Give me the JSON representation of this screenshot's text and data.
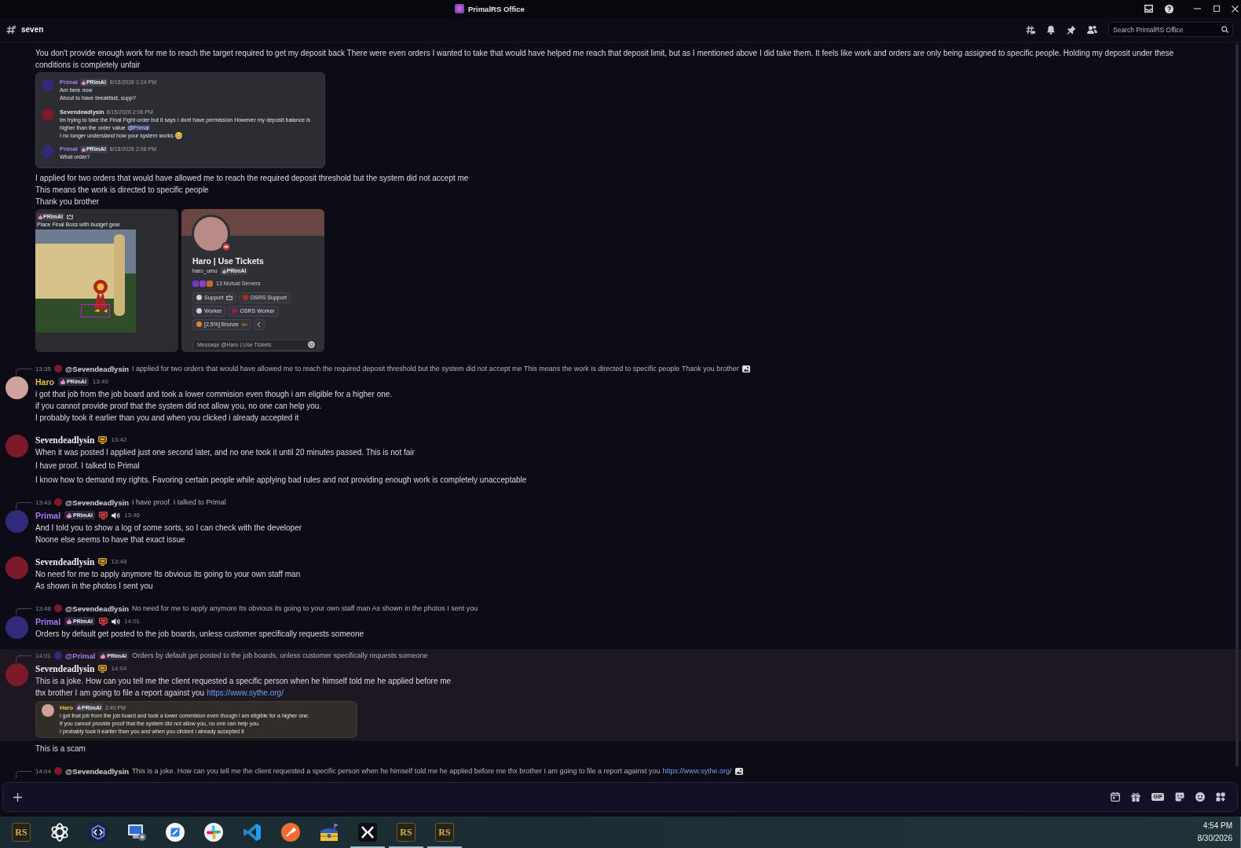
{
  "window": {
    "title": "PrimalRS Office"
  },
  "channel_header": {
    "channel": "seven",
    "search": {
      "placeholder": "Search PrimalRS Office"
    }
  },
  "messages": [
    {
      "highlighted": false,
      "blocks": [
        {
          "kind": "text",
          "lines": [
            {
              "text": "You don't provide enough work for me to reach the target required to get my deposit back There were even orders I wanted to take that would have helped me reach that deposit limit, but as I mentioned above I did take them. It feels like work and orders are only being assigned to specific people. Holding my deposit under these conditions is completely unfair"
            }
          ]
        },
        {
          "kind": "chat-screenshot",
          "messages": [
            {
              "name": "Primal",
              "color": "#a47cf5",
              "avatar": {
                "color": "#302a78"
              },
              "badge": "PRimAl",
              "time": "8/15/2026 1:24 PM",
              "lines": [
                {
                  "text": "Am here now"
                },
                {
                  "text": "About to have breakfast, supp?"
                }
              ]
            },
            {
              "name": "Sevendeadlysin",
              "color": "#e4e4e8",
              "avatar": {
                "color": "#7c1a2a"
              },
              "time": "8/15/2026 2:06 PM",
              "lines": [
                {
                  "text": "Im trying to take the Final Fight order but it says I dont have permission However my deposit balance is higher than the order value",
                  "mention": "@Primal"
                },
                {
                  "text": "I no longer understand how your system works",
                  "emoji": true
                }
              ]
            },
            {
              "name": "Primal",
              "color": "#a47cf5",
              "avatar": {
                "color": "#302a78"
              },
              "badge": "PRimAl",
              "time": "8/15/2026 2:08 PM",
              "lines": [
                {
                  "text": "What order?"
                }
              ]
            }
          ]
        },
        {
          "kind": "text",
          "lines": [
            {
              "text": "I applied for two orders that would have allowed me to reach the required deposit threshold but the system did not accept me"
            },
            {
              "text": "This means the work is directed to specific people"
            },
            {
              "text": "Thank you brother"
            }
          ]
        },
        {
          "kind": "image-row",
          "images": [
            {
              "kind": "game-screenshot",
              "badge": "PRimAl",
              "caption": "Place Final Boss with budget gear"
            },
            {
              "kind": "profile-card",
              "name": "Haro | Use Tickets",
              "username": "haro_umu",
              "badge": "PRimAl",
              "mutual": "13 Mutual Servers",
              "roles": [
                {
                  "kind": "crowned",
                  "label": "Support",
                  "color": "#d0d0d4"
                },
                {
                  "kind": "plain",
                  "label": "OSRS Support",
                  "color": "#b02a22"
                },
                {
                  "kind": "plain",
                  "label": "Worker",
                  "color": "#d0d0d4"
                },
                {
                  "kind": "plain",
                  "label": "OSRS Worker",
                  "color": "#8f1f4d"
                },
                {
                  "kind": "ranked",
                  "label": "[2.5%] Bronze",
                  "color": "#dc862e"
                }
              ],
              "placeholder": "Message @Haro | Use Tickets"
            }
          ]
        }
      ]
    },
    {
      "highlighted": false,
      "reply": {
        "time": "13:35",
        "name": "@Sevendeadlysin",
        "color": "#d6d7dd",
        "avatar": {
          "color": "#7c1a2a"
        },
        "text": "I applied for two orders that would have allowed me to reach the required deposit threshold but the system did not accept me This means the work is directed to specific people Thank you brother",
        "image": true
      },
      "author": {
        "name": "Haro",
        "color": "#e7bf45",
        "fancy_name": false,
        "avatar": {
          "color": "#cfa39b"
        },
        "badge": "PRimAl"
      },
      "time": "13:40",
      "blocks": [
        {
          "kind": "text",
          "lines": [
            {
              "text": "i got that job from the job board and took a lower commision even though i am eligible for a higher one."
            },
            {
              "text": "if you cannot provide proof that the system did not allow you, no one can help you."
            },
            {
              "text": "I probably took it earlier than you and when you clicked i already accepted it"
            }
          ]
        }
      ]
    },
    {
      "highlighted": false,
      "author": {
        "name": "Sevendeadlysin",
        "color": "#f0f0f2",
        "fancy_name": true,
        "avatar": {
          "color": "#7c1a2a"
        },
        "icons": [
          {
            "kind": "screen",
            "color": "#e2a72e"
          }
        ]
      },
      "time": "13:42",
      "blocks": [
        {
          "kind": "text",
          "lines": [
            {
              "text": "When it was posted I applied just one second later, and no one took it until 20 minutes passed. This is not fair"
            }
          ]
        },
        {
          "kind": "text",
          "lines": [
            {
              "text": "I have proof. I talked to Primal"
            }
          ]
        },
        {
          "kind": "text",
          "lines": [
            {
              "text": "I know how to demand my rights. Favoring certain people while applying bad rules and not providing enough work is completely unacceptable"
            }
          ]
        }
      ]
    },
    {
      "highlighted": false,
      "reply": {
        "time": "13:43",
        "name": "@Sevendeadlysin",
        "color": "#d6d7dd",
        "avatar": {
          "color": "#7c1a2a"
        },
        "text": "I have proof. I talked to Primal",
        "image": false
      },
      "author": {
        "name": "Primal",
        "color": "#a47cf5",
        "fancy_name": false,
        "avatar": {
          "color": "#302a78"
        },
        "badge": "PRimAl",
        "icons": [
          {
            "kind": "screen",
            "color": "#e0454c"
          },
          {
            "kind": "speaker"
          }
        ]
      },
      "time": "13:46",
      "blocks": [
        {
          "kind": "text",
          "lines": [
            {
              "text": "And I told you to show a log of some sorts, so I can check with the developer"
            },
            {
              "text": "Noone else seems to have that exact issue"
            }
          ]
        }
      ]
    },
    {
      "highlighted": false,
      "author": {
        "name": "Sevendeadlysin",
        "color": "#f0f0f2",
        "fancy_name": true,
        "avatar": {
          "color": "#7c1a2a"
        },
        "icons": [
          {
            "kind": "screen",
            "color": "#e2a72e"
          }
        ]
      },
      "time": "13:48",
      "blocks": [
        {
          "kind": "text",
          "lines": [
            {
              "text": "No need for me to apply anymore Its obvious its going to your own staff man"
            },
            {
              "text": "As shown in the photos I sent you"
            }
          ]
        }
      ]
    },
    {
      "highlighted": false,
      "reply": {
        "time": "13:48",
        "name": "@Sevendeadlysin",
        "color": "#d6d7dd",
        "avatar": {
          "color": "#7c1a2a"
        },
        "text": "No need for me to apply anymore Its obvious its going to your own staff man As shown in the photos I sent you",
        "image": false
      },
      "author": {
        "name": "Primal",
        "color": "#a47cf5",
        "fancy_name": false,
        "avatar": {
          "color": "#302a78"
        },
        "badge": "PRimAl",
        "icons": [
          {
            "kind": "screen",
            "color": "#e0454c"
          },
          {
            "kind": "speaker"
          }
        ]
      },
      "time": "14:01",
      "blocks": [
        {
          "kind": "text",
          "lines": [
            {
              "text": "Orders by default get posted to the job boards, unless customer specifically requests someone"
            }
          ]
        }
      ]
    },
    {
      "highlighted": true,
      "reply": {
        "time": "14:01",
        "name": "@Primal",
        "color": "#a47cf5",
        "avatar": {
          "color": "#302a78"
        },
        "badge": "PRimAl",
        "text": "Orders by default get posted to the job boards, unless customer specifically requests someone",
        "image": false
      },
      "author": {
        "name": "Sevendeadlysin",
        "color": "#f0f0f2",
        "fancy_name": true,
        "avatar": {
          "color": "#7c1a2a"
        },
        "icons": [
          {
            "kind": "screen",
            "color": "#e2a72e"
          }
        ]
      },
      "time": "14:04",
      "blocks": [
        {
          "kind": "text",
          "lines": [
            {
              "text": "This is a joke. How can you tell me the client requested a specific person when he himself told me he applied before me"
            },
            {
              "text": "thx brother I am going to file a report against you",
              "link": "https://www.sythe.org/"
            }
          ]
        },
        {
          "kind": "chat-screenshot",
          "messages": [
            {
              "name": "Haro",
              "color": "#e7bf45",
              "avatar": {
                "color": "#cfa39b"
              },
              "badge": "PRimAl",
              "time": "2:40 PM",
              "lines": [
                {
                  "text": "i got that job from the job board and took a lower commision even though i am eligible for a higher one."
                },
                {
                  "text": "if you cannot provide proof that the system did not allow you, no one can help you."
                },
                {
                  "text": "I probably took it earlier than you and when you clicked i already accepted it"
                }
              ]
            }
          ]
        }
      ]
    },
    {
      "highlighted": false,
      "blocks": [
        {
          "kind": "text",
          "lines": [
            {
              "text": "This is a scam"
            }
          ]
        }
      ]
    },
    {
      "highlighted": false,
      "reply": {
        "time": "14:04",
        "name": "@Sevendeadlysin",
        "color": "#d6d7dd",
        "avatar": {
          "color": "#7c1a2a"
        },
        "text": "This is a joke. How can you tell me the client requested a specific person when he himself told me he applied before me thx brother I am going to file a report against you",
        "link": "https://www.sythe.org/",
        "image": true
      }
    }
  ],
  "composer": {
    "gif_button": "GIF"
  },
  "taskbar": {
    "apps": [
      {
        "kind": "rs",
        "label": "RS",
        "running": false
      },
      {
        "kind": "knot",
        "running": false
      },
      {
        "kind": "hex",
        "running": false
      },
      {
        "kind": "remote",
        "running": false
      },
      {
        "kind": "ring",
        "running": false
      },
      {
        "kind": "pinwheel",
        "running": false
      },
      {
        "kind": "ribbon",
        "running": false
      },
      {
        "kind": "circle",
        "running": false
      },
      {
        "kind": "chest",
        "running": false
      },
      {
        "kind": "x",
        "running": true
      },
      {
        "kind": "rs",
        "label": "RS",
        "running": true
      },
      {
        "kind": "rs",
        "label": "RS",
        "running": true
      }
    ],
    "clock": {
      "time": "4:54 PM",
      "date": "8/30/2026"
    }
  }
}
